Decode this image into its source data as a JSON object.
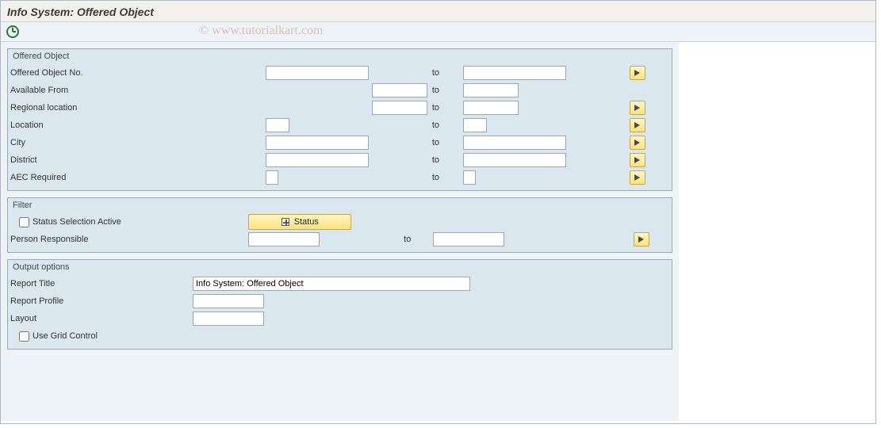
{
  "title": "Info System: Offered Object",
  "watermark": "© www.tutorialkart.com",
  "to_label": "to",
  "groups": {
    "offered": {
      "title": "Offered Object",
      "rows": {
        "object_no": {
          "label": "Offered Object No.",
          "has_range_btn": true
        },
        "avail_from": {
          "label": "Available From",
          "has_range_btn": false
        },
        "regional": {
          "label": "Regional location",
          "has_range_btn": true
        },
        "location": {
          "label": "Location",
          "has_range_btn": true
        },
        "city": {
          "label": "City",
          "has_range_btn": true
        },
        "district": {
          "label": "District",
          "has_range_btn": true
        },
        "aec": {
          "label": "AEC Required",
          "has_range_btn": true
        }
      }
    },
    "filter": {
      "title": "Filter",
      "status_active_label": "Status Selection Active",
      "status_btn_label": "Status",
      "person_resp_label": "Person Responsible"
    },
    "output": {
      "title": "Output options",
      "report_title_label": "Report Title",
      "report_title_value": "Info System: Offered Object",
      "report_profile_label": "Report Profile",
      "layout_label": "Layout",
      "grid_label": "Use Grid Control"
    }
  }
}
